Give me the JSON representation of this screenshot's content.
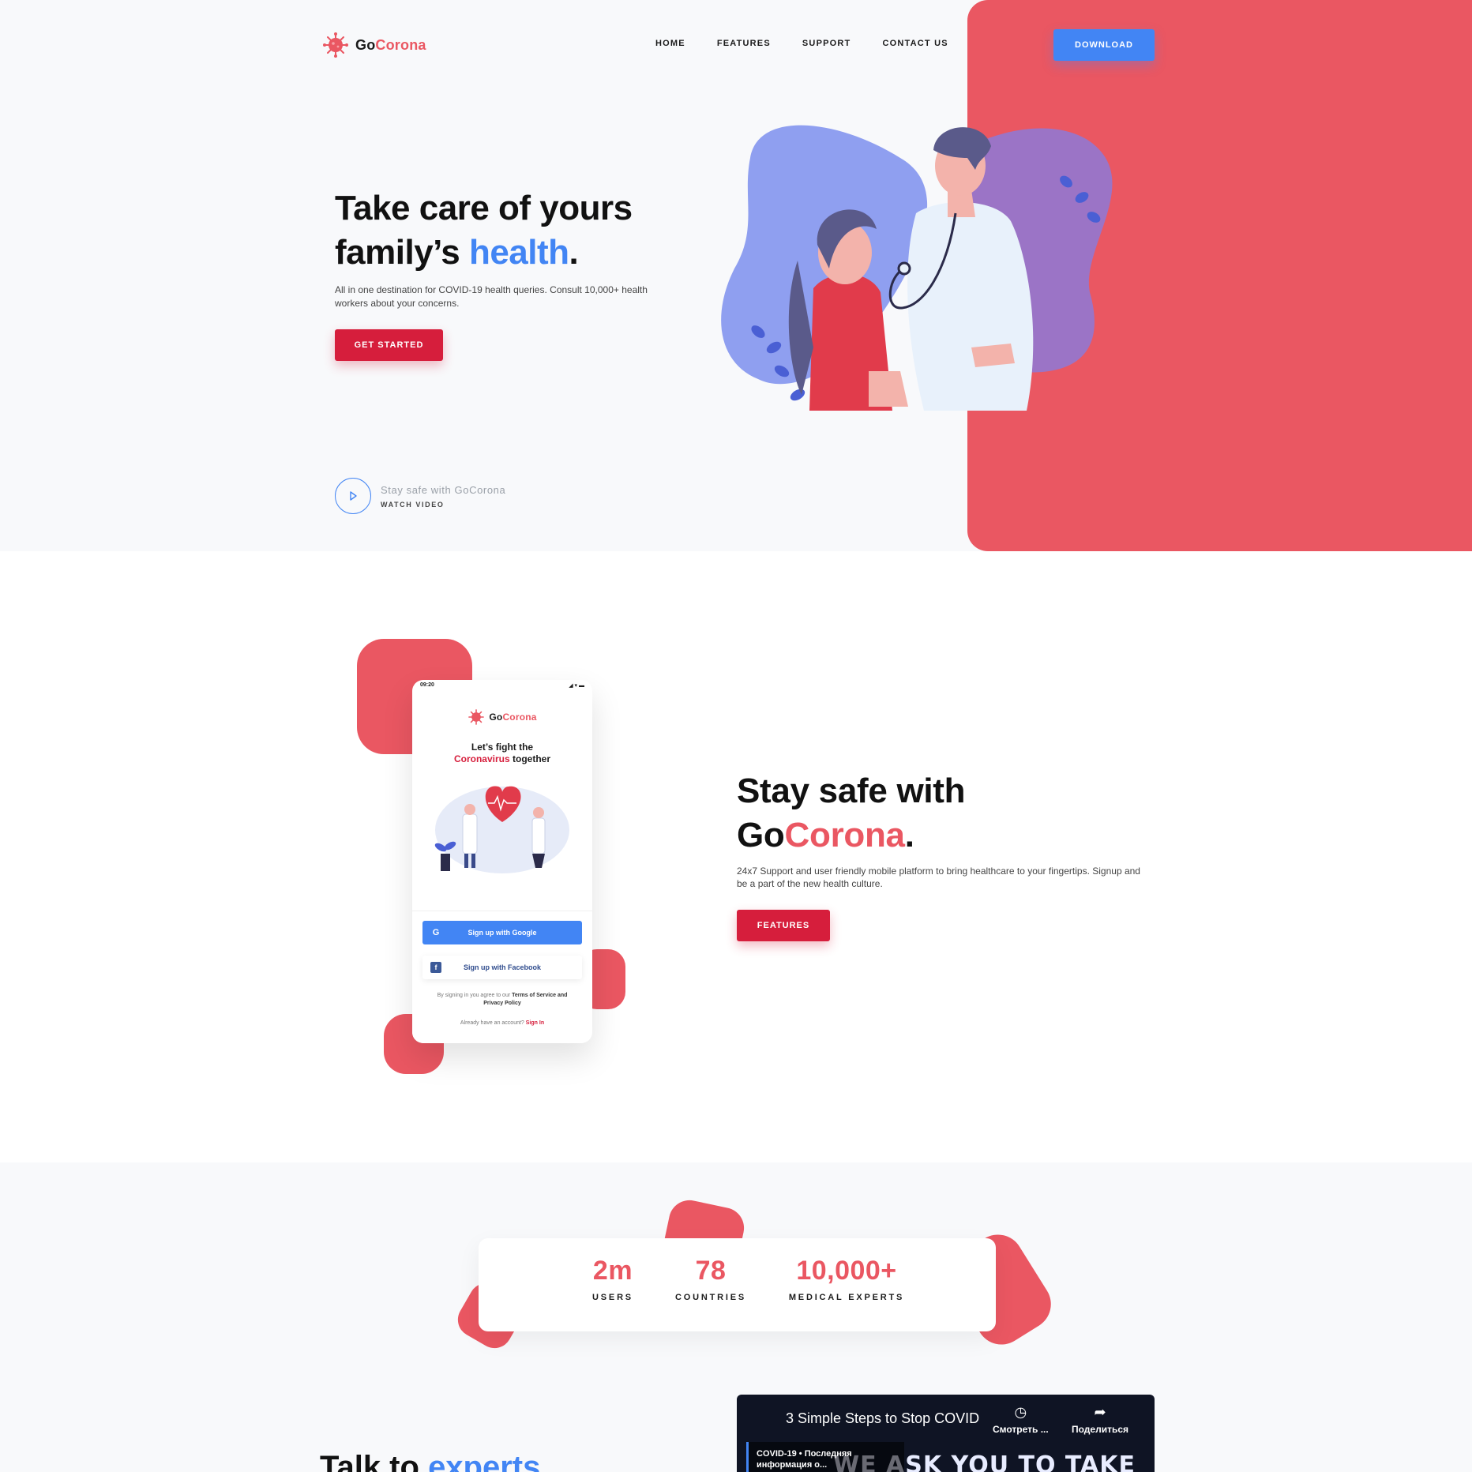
{
  "colors": {
    "brand_red": "#ea5762",
    "accent_blue": "#4285f4",
    "cta_red": "#d61e3c"
  },
  "brand": {
    "go": "Go",
    "corona": "Corona"
  },
  "nav": {
    "links": [
      "HOME",
      "FEATURES",
      "SUPPORT",
      "CONTACT US"
    ],
    "download": "DOWNLOAD"
  },
  "hero": {
    "title_line1": "Take care of yours",
    "title_line2_pre": "family’s ",
    "title_line2_accent": "health",
    "title_line2_post": ".",
    "subtitle": "All in one destination for COVID-19 health queries. Consult 10,000+ health workers about your concerns.",
    "cta": "GET STARTED",
    "watch_title": "Stay safe with GoCorona",
    "watch_sub": "WATCH VIDEO"
  },
  "phone": {
    "time": "09:20",
    "headline_1": "Let’s fight the",
    "headline_red": "Coronavirus",
    "headline_2": " together",
    "google_btn": "Sign up with Google",
    "facebook_btn": "Sign up with Facebook",
    "terms_pre": "By signing in you agree to our ",
    "terms_link": "Terms of Service and Privacy Policy",
    "signin_pre": "Already have an account? ",
    "signin_link": "Sign In"
  },
  "section2": {
    "title_line1": "Stay safe with",
    "title_go": "Go",
    "title_corona": "Corona",
    "title_dot": ".",
    "subtitle": "24x7 Support and user friendly mobile platform to bring healthcare to your fingertips. Signup and be a part of the new health culture.",
    "cta": "FEATURES"
  },
  "stats": [
    {
      "value": "2m",
      "label": "USERS"
    },
    {
      "value": "78",
      "label": "COUNTRIES"
    },
    {
      "value": "10,000+",
      "label": "MEDICAL EXPERTS"
    }
  ],
  "talk": {
    "pre": "Talk to ",
    "accent": "experts"
  },
  "video": {
    "title": "3 Simple Steps to Stop COVID",
    "watch_later": "Смотреть ...",
    "share": "Поделиться",
    "card_line1": "COVID-19 • Последняя",
    "card_line2": "информация о...",
    "overlay": "WE ASK YOU TO TAKE"
  }
}
